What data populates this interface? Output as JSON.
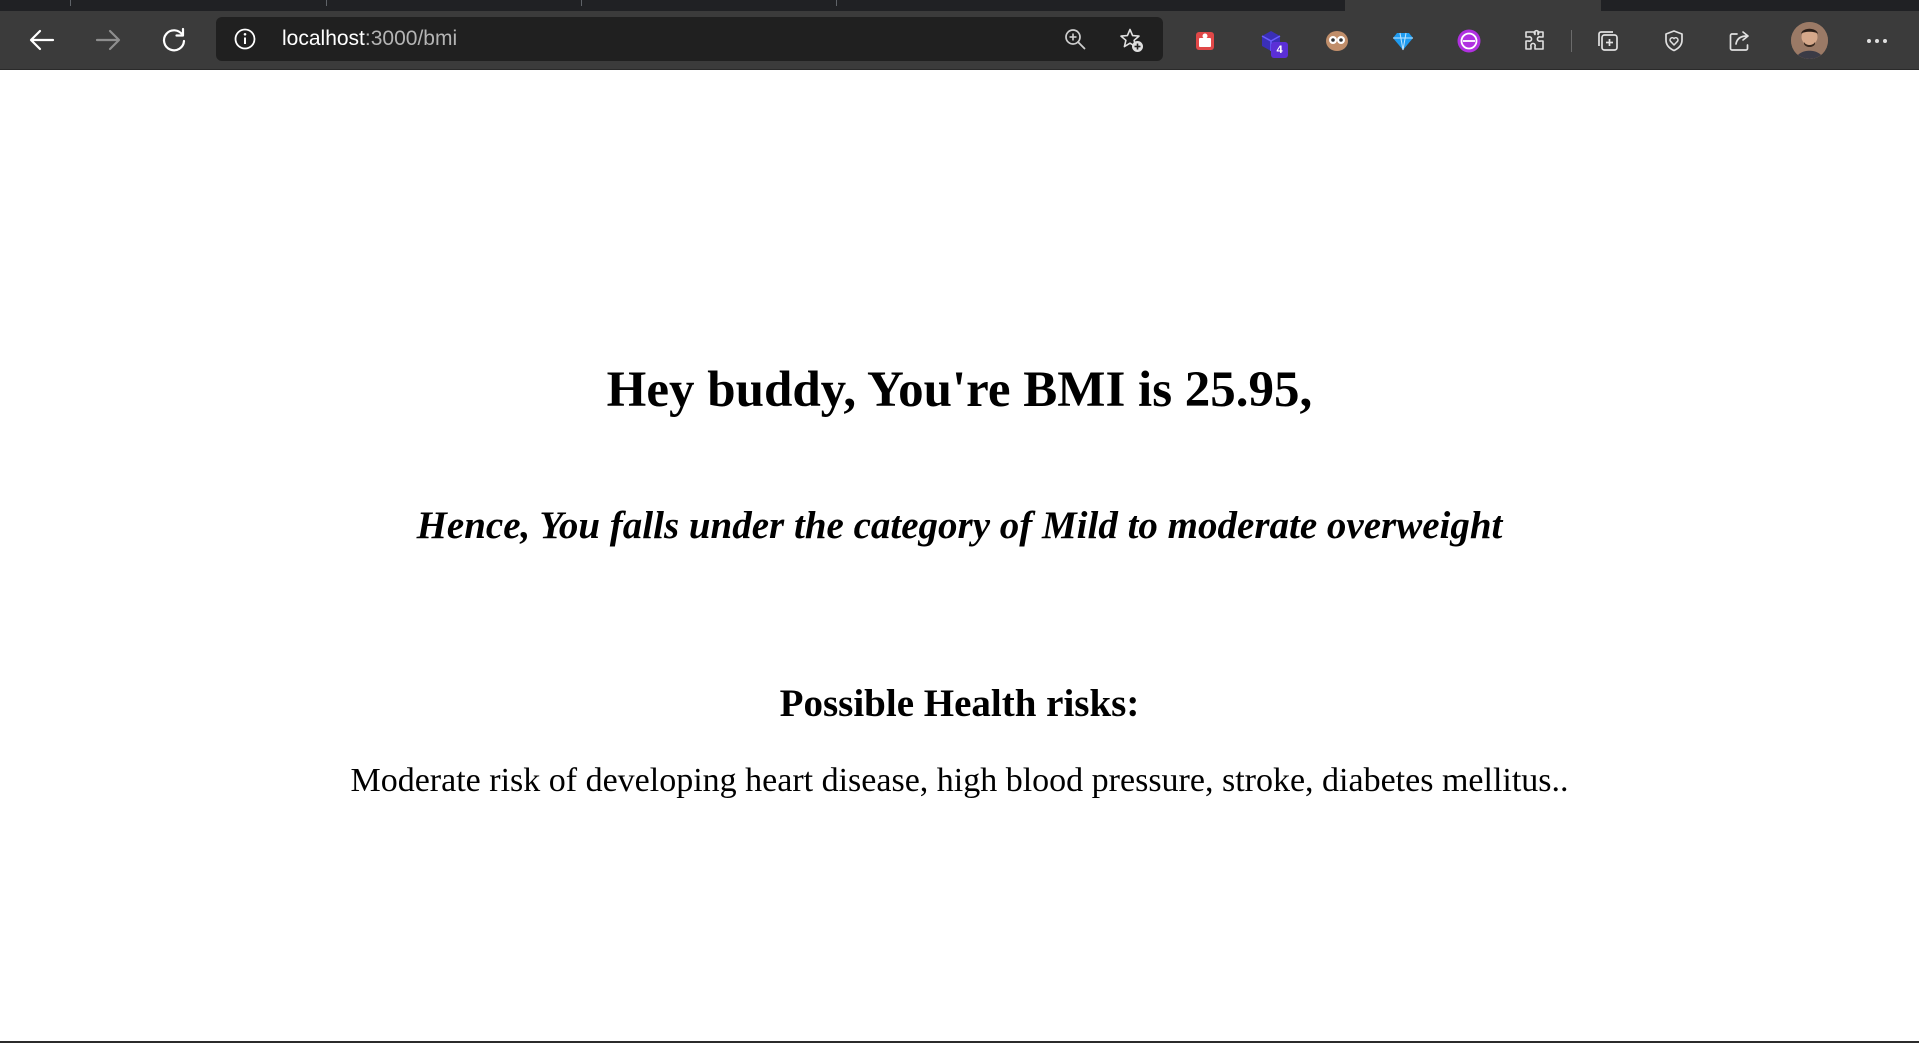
{
  "browser": {
    "url_host": "localhost",
    "url_rest": ":3000/bmi",
    "extension_badge": "4",
    "colors": {
      "toolbar": "#3b3b3b",
      "tabstrip": "#202124",
      "addressbar": "#202020"
    },
    "icons": {
      "back": "arrow-left-icon",
      "forward": "arrow-right-icon",
      "refresh": "refresh-icon",
      "site_info": "info-icon",
      "zoom": "zoom-in-icon",
      "favorite": "add-favorite-icon",
      "extensions": "puzzle-icon",
      "collections": "collections-icon",
      "browser_essentials": "heart-shield-icon",
      "share": "share-icon",
      "more": "more-dots-icon"
    }
  },
  "page": {
    "heading": "Hey buddy, You're BMI is 25.95,",
    "category_line": "Hence, You falls under the category of Mild to moderate overweight",
    "risks_heading": "Possible Health risks:",
    "risks_text": "Moderate risk of developing heart disease, high blood pressure, stroke, diabetes mellitus.."
  }
}
